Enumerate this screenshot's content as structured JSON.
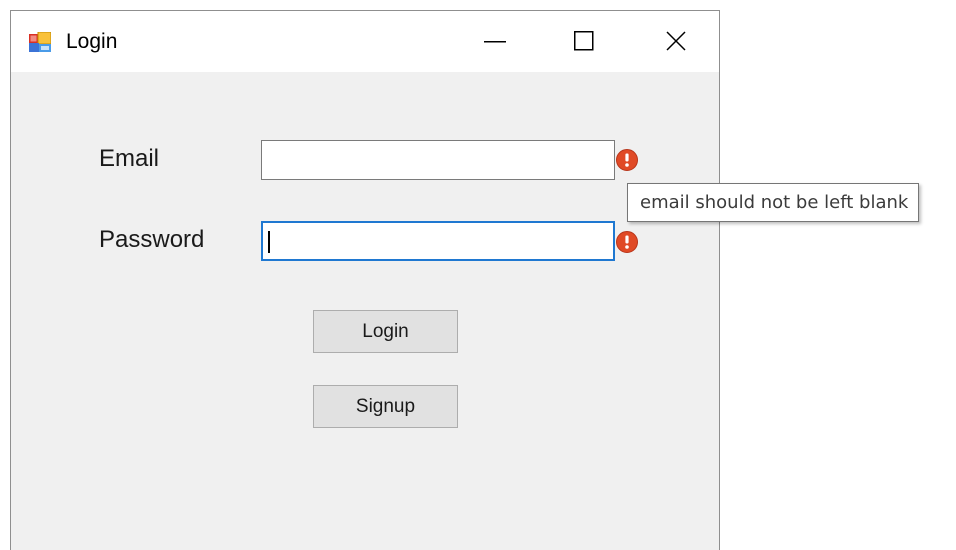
{
  "window": {
    "title": "Login",
    "icon": "winforms-app-icon",
    "controls": {
      "minimize": "minimize-icon",
      "maximize": "maximize-icon",
      "close": "close-icon"
    }
  },
  "form": {
    "email_label": "Email",
    "email_value": "",
    "password_label": "Password",
    "password_value": "",
    "login_button": "Login",
    "signup_button": "Signup"
  },
  "validation": {
    "error_icon": "error-exclamation-icon",
    "error_color": "#e04a26",
    "tooltip_text": "email should not be left blank"
  },
  "colors": {
    "focus_border": "#1f78d1",
    "window_bg": "#f0f0f0",
    "button_bg": "#e1e1e1"
  }
}
